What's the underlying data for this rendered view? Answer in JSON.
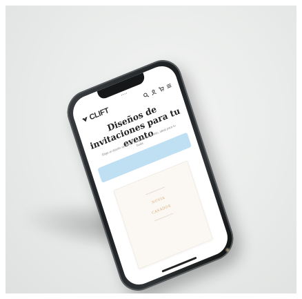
{
  "brand": {
    "name": "CLIFT"
  },
  "page": {
    "title": "Diseños de invitaciones para tu evento",
    "subtitle": "Elige el diseño que más se ajuste a tu estilo, ideal para tu boda."
  },
  "card": {
    "line1": "NOVIA",
    "line2": "CASADOS"
  },
  "icons": {
    "search": "search-icon",
    "user": "user-icon",
    "cart": "cart-icon",
    "menu": "menu-icon"
  },
  "colors": {
    "accent": "#bfdff3",
    "gold": "#d7a976",
    "phone": "#1d2022"
  }
}
